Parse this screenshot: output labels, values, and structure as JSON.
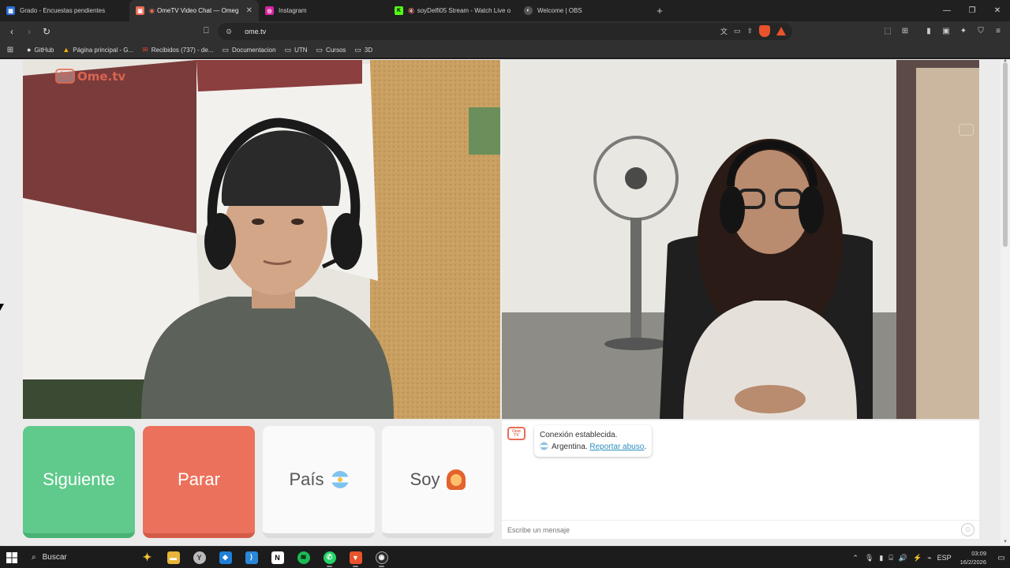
{
  "browser": {
    "tabs": [
      {
        "title": "Grado - Encuestas pendientes",
        "icon": "form-icon",
        "color": "#2b6fd6",
        "glyph": "▦",
        "active": false
      },
      {
        "title": "OmeTV Video Chat — Omeg",
        "icon": "ometv-icon",
        "color": "#e86d55",
        "glyph": "▣",
        "active": true,
        "close": "✕",
        "audio": "◉"
      },
      {
        "title": "Instagram",
        "icon": "instagram-icon",
        "color": "#d6249f",
        "glyph": "◎",
        "active": false
      },
      {
        "title": "soyDelfi05 Stream - Watch Live o",
        "icon": "kick-icon",
        "color": "#53fc18",
        "glyph": "K",
        "active": false,
        "muted": "🔇"
      },
      {
        "title": "Welcome | OBS",
        "icon": "obs-icon",
        "color": "#555555",
        "glyph": "◐",
        "active": false
      }
    ],
    "new_tab": "+",
    "window_controls": {
      "minimize": "—",
      "maximize": "❐",
      "close": "✕"
    },
    "nav": {
      "back": "‹",
      "forward": "›",
      "reload": "↻",
      "bookmark": "⎕"
    },
    "url": "ome.tv",
    "site_info": "⚙",
    "omni_icons": [
      "文",
      "▭",
      "⇪"
    ],
    "toolbar_icons": [
      "⬚",
      "⊞",
      "▮",
      "▣",
      "✦",
      "⛉",
      "≡"
    ],
    "bookmarks_apps": "⊞",
    "bookmarks": [
      {
        "label": "GitHub",
        "icon": "github-icon",
        "glyph": "●"
      },
      {
        "label": "Página principal - G...",
        "icon": "google-drive-icon",
        "glyph": "▲"
      },
      {
        "label": "Recibidos (737) - de...",
        "icon": "mail-icon",
        "glyph": "✉"
      },
      {
        "label": "Documentacion",
        "icon": "folder-icon",
        "glyph": "▭"
      },
      {
        "label": "UTN",
        "icon": "folder-icon",
        "glyph": "▭"
      },
      {
        "label": "Cursos",
        "icon": "folder-icon",
        "glyph": "▭"
      },
      {
        "label": "3D",
        "icon": "folder-icon",
        "glyph": "▭"
      }
    ]
  },
  "ometv": {
    "logo_text": "Ome.tv",
    "logo_badge": "Ome\nTV",
    "buttons": {
      "next": "Siguiente",
      "stop": "Parar",
      "country": "País",
      "gender": "Soy"
    },
    "chat": {
      "system_message": "Conexión establecida.",
      "country": "Argentina.",
      "report_link": "Reportar abuso",
      "report_suffix": ".",
      "input_placeholder": "Escribe un mensaje",
      "emoji": "☺"
    },
    "colors": {
      "next": "#5fca8b",
      "stop": "#ec715c",
      "accent": "#e86d55"
    }
  },
  "taskbar": {
    "start": "windows-start-icon",
    "search_label": "Buscar",
    "apps": [
      {
        "name": "copilot-icon",
        "glyph": "✦",
        "color": "#f2c12e",
        "open": false
      },
      {
        "name": "file-explorer-icon",
        "glyph": "▬",
        "color": "#e8b53a",
        "open": false
      },
      {
        "name": "yandex-icon",
        "glyph": "Y",
        "color": "#bbbbbb",
        "open": false
      },
      {
        "name": "outlook-icon",
        "glyph": "◆",
        "color": "#1e7fd6",
        "open": false
      },
      {
        "name": "vscode-icon",
        "glyph": "⟩",
        "color": "#2a87d8",
        "open": false
      },
      {
        "name": "notion-icon",
        "glyph": "N",
        "color": "#444444",
        "open": false
      },
      {
        "name": "spotify-icon",
        "glyph": "≋",
        "color": "#1db954",
        "open": false
      },
      {
        "name": "whatsapp-icon",
        "glyph": "✆",
        "color": "#25d366",
        "open": true
      },
      {
        "name": "brave-icon",
        "glyph": "▼",
        "color": "#e8532c",
        "open": true
      },
      {
        "name": "obs-icon",
        "glyph": "◉",
        "color": "#2b2b2b",
        "open": true
      }
    ],
    "tray": {
      "chevron": "⌃",
      "icons": [
        "🎙",
        "▮",
        "⌸",
        "🔊",
        "⚡",
        "⌁"
      ],
      "language": "ESP",
      "time": "03:09",
      "date": "16/2/2026",
      "notifications": "▭"
    }
  }
}
